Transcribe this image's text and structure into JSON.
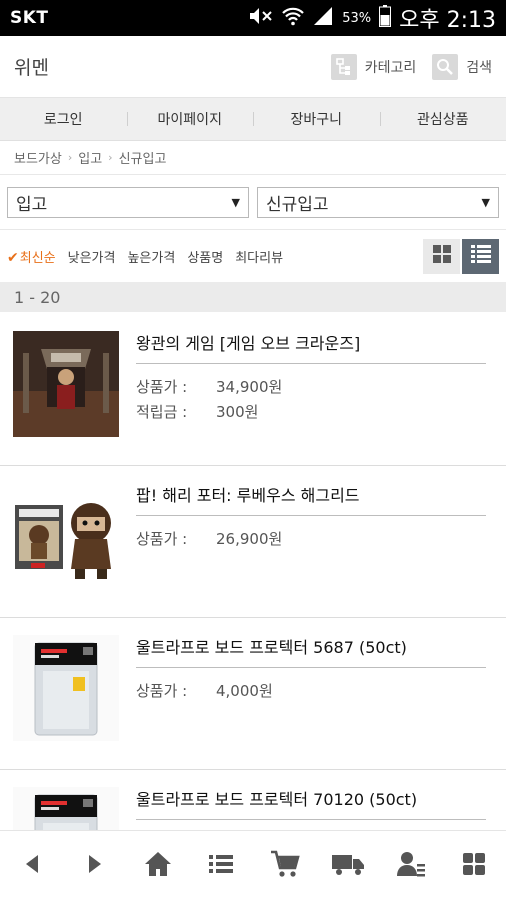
{
  "status_bar": {
    "carrier": "SKT",
    "battery": "53%",
    "time": "오후 2:13",
    "icons": [
      "mute-icon",
      "wifi-icon",
      "signal-icon",
      "battery-icon"
    ]
  },
  "header": {
    "logo": "위멘",
    "category_label": "카테고리",
    "search_label": "검색"
  },
  "menu": [
    "로그인",
    "마이페이지",
    "장바구니",
    "관심상품"
  ],
  "breadcrumb": [
    "보드가상",
    "입고",
    "신규입고"
  ],
  "filters": {
    "category": "입고",
    "subcategory": "신규입고"
  },
  "sort": {
    "options": [
      "최신순",
      "낮은가격",
      "높은가격",
      "상품명",
      "최다리뷰"
    ],
    "active": "최신순"
  },
  "range": "1 - 20",
  "products": [
    {
      "name": "왕관의 게임 [게임 오브 크라운즈]",
      "price_label": "상품가 :",
      "price": "34,900원",
      "points_label": "적립금 :",
      "points": "300원"
    },
    {
      "name": "팝! 해리 포터: 루베우스 해그리드",
      "price_label": "상품가 :",
      "price": "26,900원"
    },
    {
      "name": "울트라프로 보드 프로텍터 5687 (50ct)",
      "price_label": "상품가 :",
      "price": "4,000원"
    },
    {
      "name": "울트라프로 보드 프로텍터 70120 (50ct)"
    }
  ],
  "colors": {
    "accent": "#e8701a",
    "active_toggle": "#5d6873",
    "menu_bg": "#efefef"
  }
}
